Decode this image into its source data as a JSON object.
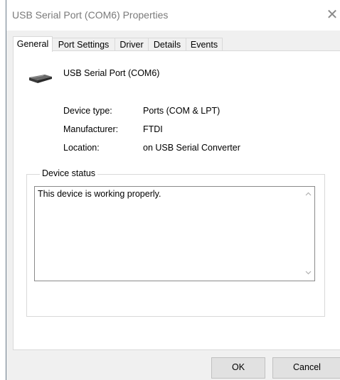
{
  "window": {
    "title": "USB Serial Port (COM6) Properties",
    "close_glyph": "✕"
  },
  "tabs": [
    {
      "label": "General",
      "active": true
    },
    {
      "label": "Port Settings",
      "active": false
    },
    {
      "label": "Driver",
      "active": false
    },
    {
      "label": "Details",
      "active": false
    },
    {
      "label": "Events",
      "active": false
    }
  ],
  "device": {
    "icon": "usb-serial-port-icon",
    "name": "USB Serial Port (COM6)"
  },
  "properties": [
    {
      "label": "Device type:",
      "value": "Ports (COM & LPT)"
    },
    {
      "label": "Manufacturer:",
      "value": "FTDI"
    },
    {
      "label": "Location:",
      "value": "on USB Serial Converter"
    }
  ],
  "device_status": {
    "legend": "Device status",
    "text": "This device is working properly."
  },
  "buttons": {
    "ok": "OK",
    "cancel": "Cancel"
  }
}
